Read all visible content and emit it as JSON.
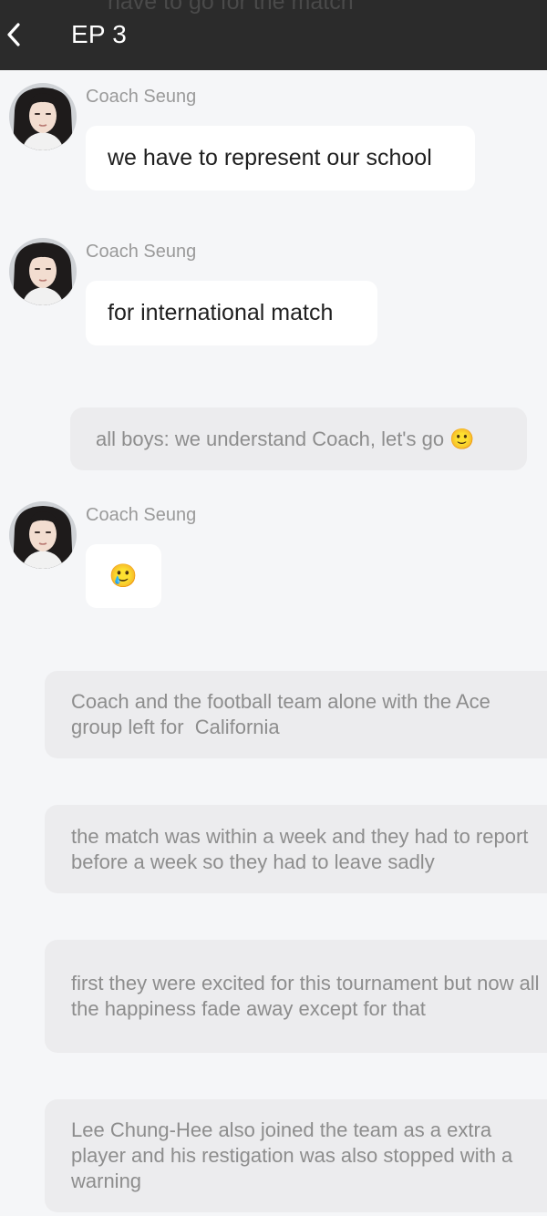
{
  "header": {
    "title": "EP 3",
    "ghost_text": "have to go for the match",
    "back_icon": "chevron-left-icon"
  },
  "colors": {
    "header_bg": "#2b2b2b",
    "page_bg": "#f5f6f8",
    "bubble_bg": "#ffffff",
    "narration_bg": "#ececee",
    "sender_text": "#9a9a9a",
    "narration_text": "#8d8d8d"
  },
  "messages": [
    {
      "sender": "Coach Seung",
      "text": "we have to represent our school",
      "avatar": "avatar-icon"
    },
    {
      "sender": "Coach Seung",
      "text": "for international match",
      "avatar": "avatar-icon"
    },
    {
      "narration": "all boys: we understand Coach, let's go 🙂"
    },
    {
      "sender": "Coach Seung",
      "text": "🥲",
      "avatar": "avatar-icon"
    },
    {
      "narration": "Coach and the football team alone with the Ace group left for  California"
    },
    {
      "narration": "the match was within a week and they had to report before a week so they had to leave sadly"
    },
    {
      "narration": "first they were excited for this tournament but now all the happiness fade away except for that"
    },
    {
      "narration": "Lee Chung-Hee also joined the team as a extra player and his restigation was also stopped with a warning"
    }
  ]
}
